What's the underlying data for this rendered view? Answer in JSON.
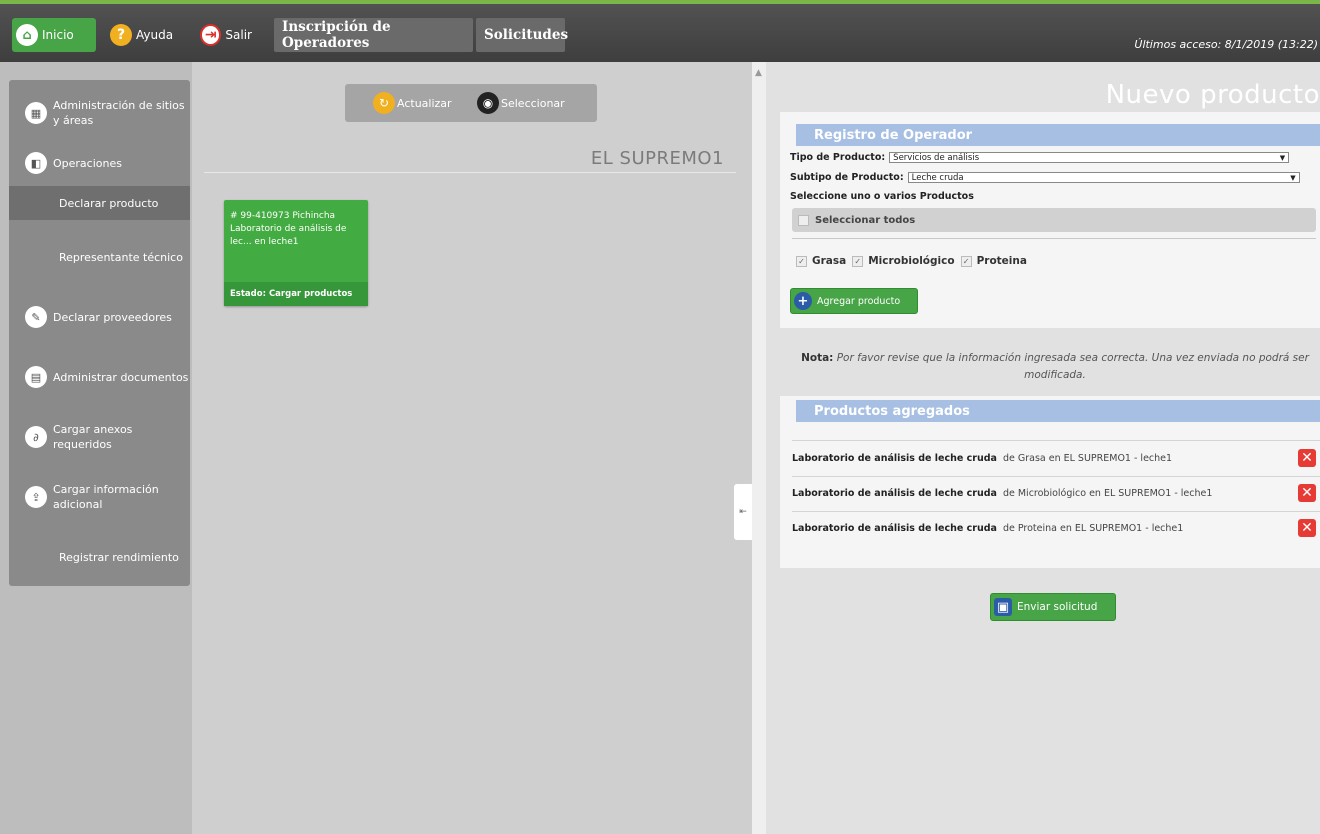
{
  "topbar": {
    "inicio": "Inicio",
    "ayuda": "Ayuda",
    "salir": "Salir",
    "tab_inscripcion": "Inscripción de Operadores",
    "tab_solicitudes": "Solicitudes",
    "last_access": "Últimos acceso: 8/1/2019 (13:22)"
  },
  "sidebar": {
    "items": [
      {
        "label": "Administración de sitios y áreas",
        "icon": "sites-icon"
      },
      {
        "label": "Operaciones",
        "icon": "operations-icon"
      },
      {
        "label": "Declarar producto"
      },
      {
        "label": "Representante técnico"
      },
      {
        "label": "Declarar proveedores",
        "icon": "suppliers-icon"
      },
      {
        "label": "Administrar documentos",
        "icon": "documents-icon"
      },
      {
        "label": "Cargar anexos requeridos",
        "icon": "paperclip-icon"
      },
      {
        "label": "Cargar información adicional",
        "icon": "info-upload-icon"
      },
      {
        "label": "Registrar rendimiento"
      }
    ]
  },
  "toolbar": {
    "actualizar": "Actualizar",
    "seleccionar": "Seleccionar"
  },
  "operator_name": "EL SUPREMO1",
  "card": {
    "line1": "# 99-410973 Pichincha",
    "line2": "Laboratorio de análisis de",
    "line3": "lec... en leche1",
    "status": "Estado: Cargar productos"
  },
  "right": {
    "title": "Nuevo producto",
    "registro_head": "Registro de Operador",
    "tipo_label": "Tipo de Producto:",
    "tipo_value": "Servicios de análisis",
    "subtipo_label": "Subtipo de Producto:",
    "subtipo_value": "Leche cruda",
    "select_products": "Seleccione uno o varios Productos",
    "select_all": "Seleccionar todos",
    "products": [
      "Grasa",
      "Microbiológico",
      "Proteina"
    ],
    "add_button": "Agregar producto",
    "nota_label": "Nota:",
    "nota_text": "Por favor revise que la información ingresada sea correcta. Una vez enviada no podrá ser modificada.",
    "agregados_head": "Productos agregados",
    "agregados": [
      {
        "bold": "Laboratorio de análisis de leche cruda",
        "rest": " de Grasa en EL SUPREMO1 - leche1"
      },
      {
        "bold": "Laboratorio de análisis de leche cruda",
        "rest": " de Microbiológico en EL SUPREMO1 - leche1"
      },
      {
        "bold": "Laboratorio de análisis de leche cruda",
        "rest": " de Proteina en EL SUPREMO1 - leche1"
      }
    ],
    "send_button": "Enviar solicitud"
  },
  "colors": {
    "accent_green": "#47a447",
    "section_blue": "#a6bfe3",
    "delete_red": "#e63a35"
  }
}
